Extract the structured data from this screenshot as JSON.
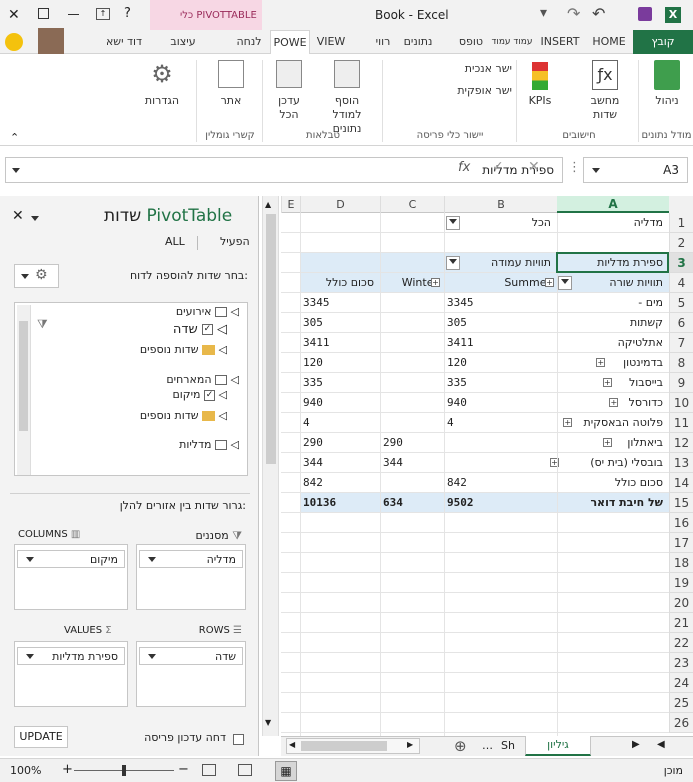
{
  "window": {
    "title": "Book - Excel",
    "context_tab_label": "כלי PIVOTTABLE"
  },
  "tabs": [
    "קובץ",
    "HOME",
    "INSERT",
    "עמוד עמוד",
    "טופס",
    "נתונים",
    "רווי",
    "VIEW",
    "POWE",
    "לנחה",
    "עיצוב",
    "דוד ישא"
  ],
  "ribbon": {
    "buttons": {
      "manage": "ניהול",
      "kpis": "KPIs",
      "calc_line1": "מחשב",
      "calc_line2": "שדות",
      "align_h": "ישר אנכית",
      "align_v": "ישר אופקית",
      "add_line1": "הוסף",
      "add_line2": "למודל נתונים",
      "update_line1": "עדכן",
      "update_line2": "הכל",
      "find": "אתר",
      "settings": "הגדרות"
    },
    "groups": {
      "model": "מודל נתונים",
      "calc": "חישובים",
      "layout": "יישור כלי פריסה",
      "tables": "טבלאות",
      "links": "קשרי גומלין"
    }
  },
  "formula_bar": {
    "name_box": "A3",
    "content": "ספירת מדליות",
    "fx": "fx"
  },
  "pane": {
    "title_pivot": "PivotTable",
    "title_fields": "שדות",
    "tab_active": "הפעיל",
    "tab_all": "ALL",
    "choose_label": "בחר שדות להוספה לדוח:",
    "tree": [
      {
        "label": "אירועים",
        "kind": "table"
      },
      {
        "label": "שדה",
        "kind": "field"
      },
      {
        "label": "שדות נוספים",
        "kind": "folder"
      },
      {
        "label": "המארחים",
        "kind": "table"
      },
      {
        "label": "מיקום",
        "kind": "field"
      },
      {
        "label": "שדות נוספים",
        "kind": "folder"
      },
      {
        "label": "מדליות",
        "kind": "table"
      }
    ],
    "drag_label": "גרור שדות בין אזורים להלן:",
    "filters_label": "מסננים",
    "columns_label": "COLUMNS",
    "rows_label": "ROWS",
    "values_label": "VALUES",
    "filters_item": "מדליה",
    "columns_item": "מיקום",
    "rows_item": "שדה",
    "values_item": "ספירת מדליות",
    "defer_label": "דחה עדכון פריסה",
    "update_button": "UPDATE"
  },
  "grid": {
    "col_headers": [
      "A",
      "B",
      "C",
      "D",
      "E"
    ],
    "rows": [
      {
        "n": "1",
        "a": "מדליה",
        "b": "הכל",
        "c": "",
        "d": ""
      },
      {
        "n": "2",
        "a": "",
        "b": "",
        "c": "",
        "d": ""
      },
      {
        "n": "3",
        "a": "ספירת מדליות",
        "b": "תוויות עמודה",
        "c": "",
        "d": ""
      },
      {
        "n": "4",
        "a": "תוויות שורה",
        "b": "Summer",
        "c": "Winter",
        "d": "סכום כולל"
      },
      {
        "n": "5",
        "a": "- מים",
        "b": "3345",
        "c": "",
        "d": "3345"
      },
      {
        "n": "6",
        "a": "קשתות",
        "b": "305",
        "c": "",
        "d": "305"
      },
      {
        "n": "7",
        "a": "אתלטיקה",
        "b": "3411",
        "c": "",
        "d": "3411"
      },
      {
        "n": "8",
        "a": "בדמינטון",
        "b": "120",
        "c": "",
        "d": "120"
      },
      {
        "n": "9",
        "a": "בייסבול",
        "b": "335",
        "c": "",
        "d": "335"
      },
      {
        "n": "10",
        "a": "כדורסל",
        "b": "940",
        "c": "",
        "d": "940"
      },
      {
        "n": "11",
        "a": "פלוטה הבאסקית",
        "b": "4",
        "c": "",
        "d": "4"
      },
      {
        "n": "12",
        "a": "ביאתלון",
        "b": "",
        "c": "290",
        "d": "290"
      },
      {
        "n": "13",
        "a": "בובסלי (בית יס)",
        "b": "",
        "c": "344",
        "d": "344"
      },
      {
        "n": "14",
        "a": "סכום כולל",
        "b": "842",
        "c": "",
        "d": "842"
      },
      {
        "n": "15",
        "a": "של חיבת דואר",
        "b": "9502",
        "c": "634",
        "d": "10136"
      },
      {
        "n": "16"
      },
      {
        "n": "17"
      },
      {
        "n": "18"
      },
      {
        "n": "19"
      },
      {
        "n": "20"
      },
      {
        "n": "21"
      },
      {
        "n": "22"
      },
      {
        "n": "23"
      },
      {
        "n": "24"
      },
      {
        "n": "25"
      },
      {
        "n": "26"
      }
    ]
  },
  "sheets": {
    "active": "גיליון",
    "other": "Sh"
  },
  "status": {
    "ready": "מוכן",
    "zoom": "100%"
  }
}
